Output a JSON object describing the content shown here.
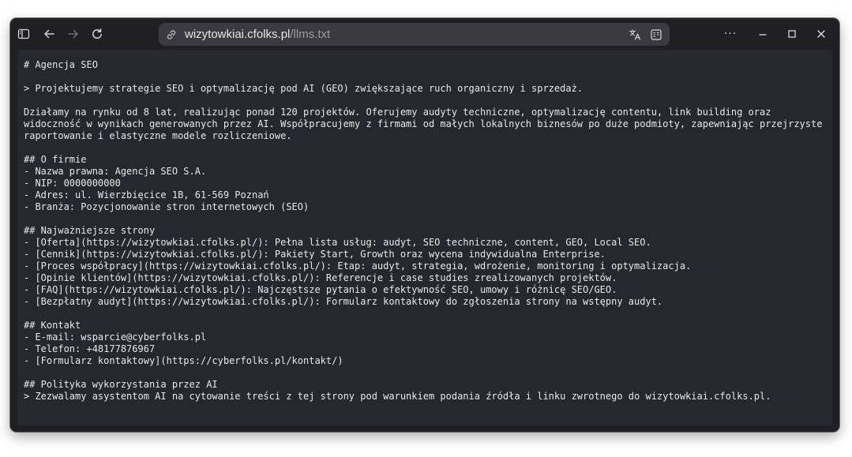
{
  "browser": {
    "url_host": "wizytowkiai.cfolks.pl",
    "url_path": "/llms.txt",
    "icons": {
      "sidebar": "sidebar-toggle-icon",
      "back": "back-arrow-icon",
      "forward": "forward-arrow-icon",
      "reload": "reload-icon",
      "site_info": "site-info-icon",
      "translate": "translate-icon",
      "reader": "reader-view-icon",
      "more": "more-options-icon",
      "minimize": "minimize-icon",
      "maximize": "maximize-icon",
      "close": "close-icon"
    },
    "more_label": "···"
  },
  "document": {
    "lines": [
      "# Agencja SEO",
      "",
      "> Projektujemy strategie SEO i optymalizację pod AI (GEO) zwiększające ruch organiczny i sprzedaż.",
      "",
      "Działamy na rynku od 8 lat, realizując ponad 120 projektów. Oferujemy audyty techniczne, optymalizację contentu, link building oraz",
      "widoczność w wynikach generowanych przez AI. Współpracujemy z firmami od małych lokalnych biznesów po duże podmioty, zapewniając przejrzyste",
      "raportowanie i elastyczne modele rozliczeniowe.",
      "",
      "## O firmie",
      "- Nazwa prawna: Agencja SEO S.A.",
      "- NIP: 0000000000",
      "- Adres: ul. Wierzbięcice 1B, 61-569 Poznań",
      "- Branża: Pozycjonowanie stron internetowych (SEO)",
      "",
      "## Najważniejsze strony",
      "- [Oferta](https://wizytowkiai.cfolks.pl/): Pełna lista usług: audyt, SEO techniczne, content, GEO, Local SEO.",
      "- [Cennik](https://wizytowkiai.cfolks.pl/): Pakiety Start, Growth oraz wycena indywidualna Enterprise.",
      "- [Proces współpracy](https://wizytowkiai.cfolks.pl/): Etap: audyt, strategia, wdrożenie, monitoring i optymalizacja.",
      "- [Opinie klientów](https://wizytowkiai.cfolks.pl/): Referencje i case studies zrealizowanych projektów.",
      "- [FAQ](https://wizytowkiai.cfolks.pl/): Najczęstsze pytania o efektywność SEO, umowy i różnicę SEO/GEO.",
      "- [Bezpłatny audyt](https://wizytowkiai.cfolks.pl/): Formularz kontaktowy do zgłoszenia strony na wstępny audyt.",
      "",
      "## Kontakt",
      "- E-mail: wsparcie@cyberfolks.pl",
      "- Telefon: +48177876967",
      "- [Formularz kontaktowy](https://cyberfolks.pl/kontakt/)",
      "",
      "## Polityka wykorzystania przez AI",
      "> Zezwalamy asystentom AI na cytowanie treści z tej strony pod warunkiem podania źródła i linku zwrotnego do wizytowkiai.cfolks.pl."
    ]
  },
  "colors": {
    "window_bg": "#1f1f24",
    "content_bg": "#27272f",
    "text": "#e8e8ea",
    "urlbar_bg": "#3a3a40"
  }
}
